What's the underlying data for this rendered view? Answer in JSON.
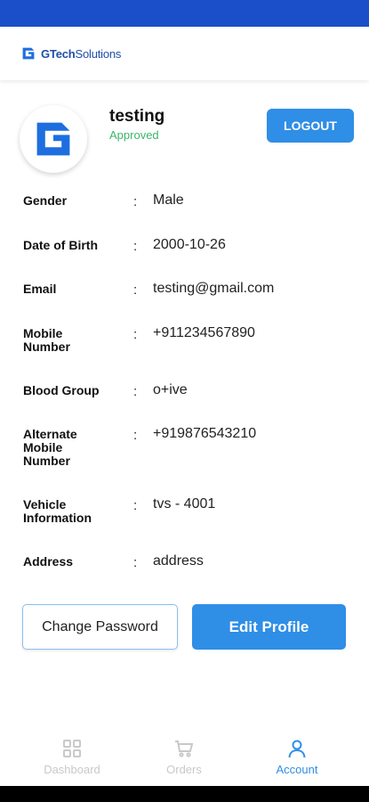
{
  "brand": {
    "name_bold": "GTech",
    "name_rest": "Solutions"
  },
  "profile": {
    "name": "testing",
    "status": "Approved",
    "logout_label": "LOGOUT"
  },
  "details": [
    {
      "label": "Gender",
      "value": "Male"
    },
    {
      "label": "Date of Birth",
      "value": "2000-10-26"
    },
    {
      "label": "Email",
      "value": "testing@gmail.com"
    },
    {
      "label": "Mobile\nNumber",
      "value": "+911234567890"
    },
    {
      "label": "Blood Group",
      "value": "o+ive"
    },
    {
      "label": "Alternate\nMobile\nNumber",
      "value": "+919876543210"
    },
    {
      "label": "Vehicle\nInformation",
      "value": "tvs - 4001"
    },
    {
      "label": "Address",
      "value": "address"
    }
  ],
  "separator": ":",
  "actions": {
    "change_password": "Change Password",
    "edit_profile": "Edit Profile"
  },
  "nav": [
    {
      "label": "Dashboard",
      "icon": "dashboard-icon",
      "active": false
    },
    {
      "label": "Orders",
      "icon": "cart-icon",
      "active": false
    },
    {
      "label": "Account",
      "icon": "account-icon",
      "active": true
    }
  ],
  "colors": {
    "accent": "#2f8ee6",
    "status_bar": "#1a4fc9",
    "approved": "#3bb56a"
  }
}
